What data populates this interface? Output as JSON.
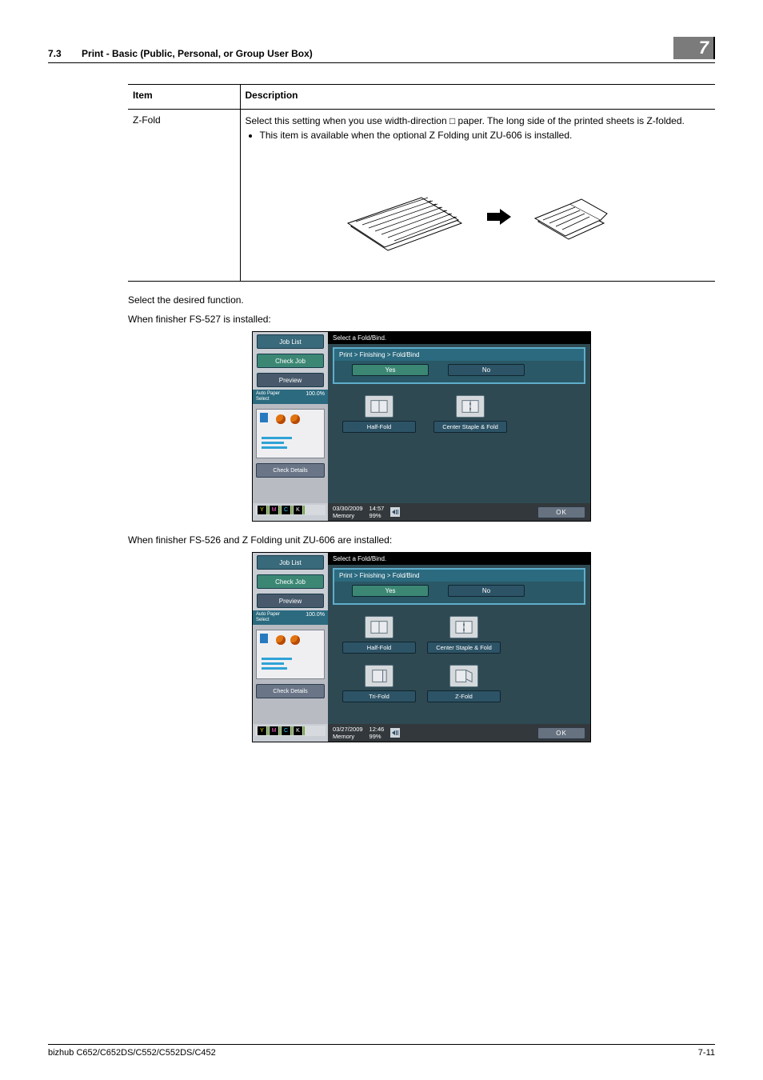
{
  "header": {
    "section_number": "7.3",
    "section_title": "Print - Basic (Public, Personal, or Group User Box)",
    "chapter_number": "7"
  },
  "table": {
    "head_item": "Item",
    "head_desc": "Description",
    "row_item": "Z-Fold",
    "row_desc_p1": "Select this setting when you use width-direction □ paper. The long side of the printed sheets is Z-folded.",
    "row_desc_li": "This item is available when the optional Z Folding unit ZU-606 is installed."
  },
  "body": {
    "para1": "Select the desired function.",
    "para2": "When finisher FS-527 is installed:",
    "para3": "When finisher FS-526 and Z Folding unit ZU-606 are installed:"
  },
  "screen": {
    "job_list": "Job List",
    "check_job": "Check Job",
    "preview": "Preview",
    "auto_paper": "Auto Paper Select",
    "mempct": "100.0%",
    "check_details": "Check Details",
    "prompt": "Select a Fold/Bind.",
    "breadcrumb": "Print > Finishing >  Fold/Bind",
    "yes": "Yes",
    "no": "No",
    "half_fold": "Half-Fold",
    "center_staple": "Center Staple & Fold",
    "tri_fold": "Tri-Fold",
    "z_fold": "Z-Fold",
    "ok": "OK",
    "date1": "03/30/2009",
    "time1": "14:57",
    "date2": "03/27/2009",
    "time2": "12:46",
    "memory_lbl": "Memory",
    "memory_pct": "99%"
  },
  "footer": {
    "model": "bizhub C652/C652DS/C552/C552DS/C452",
    "page": "7-11"
  }
}
